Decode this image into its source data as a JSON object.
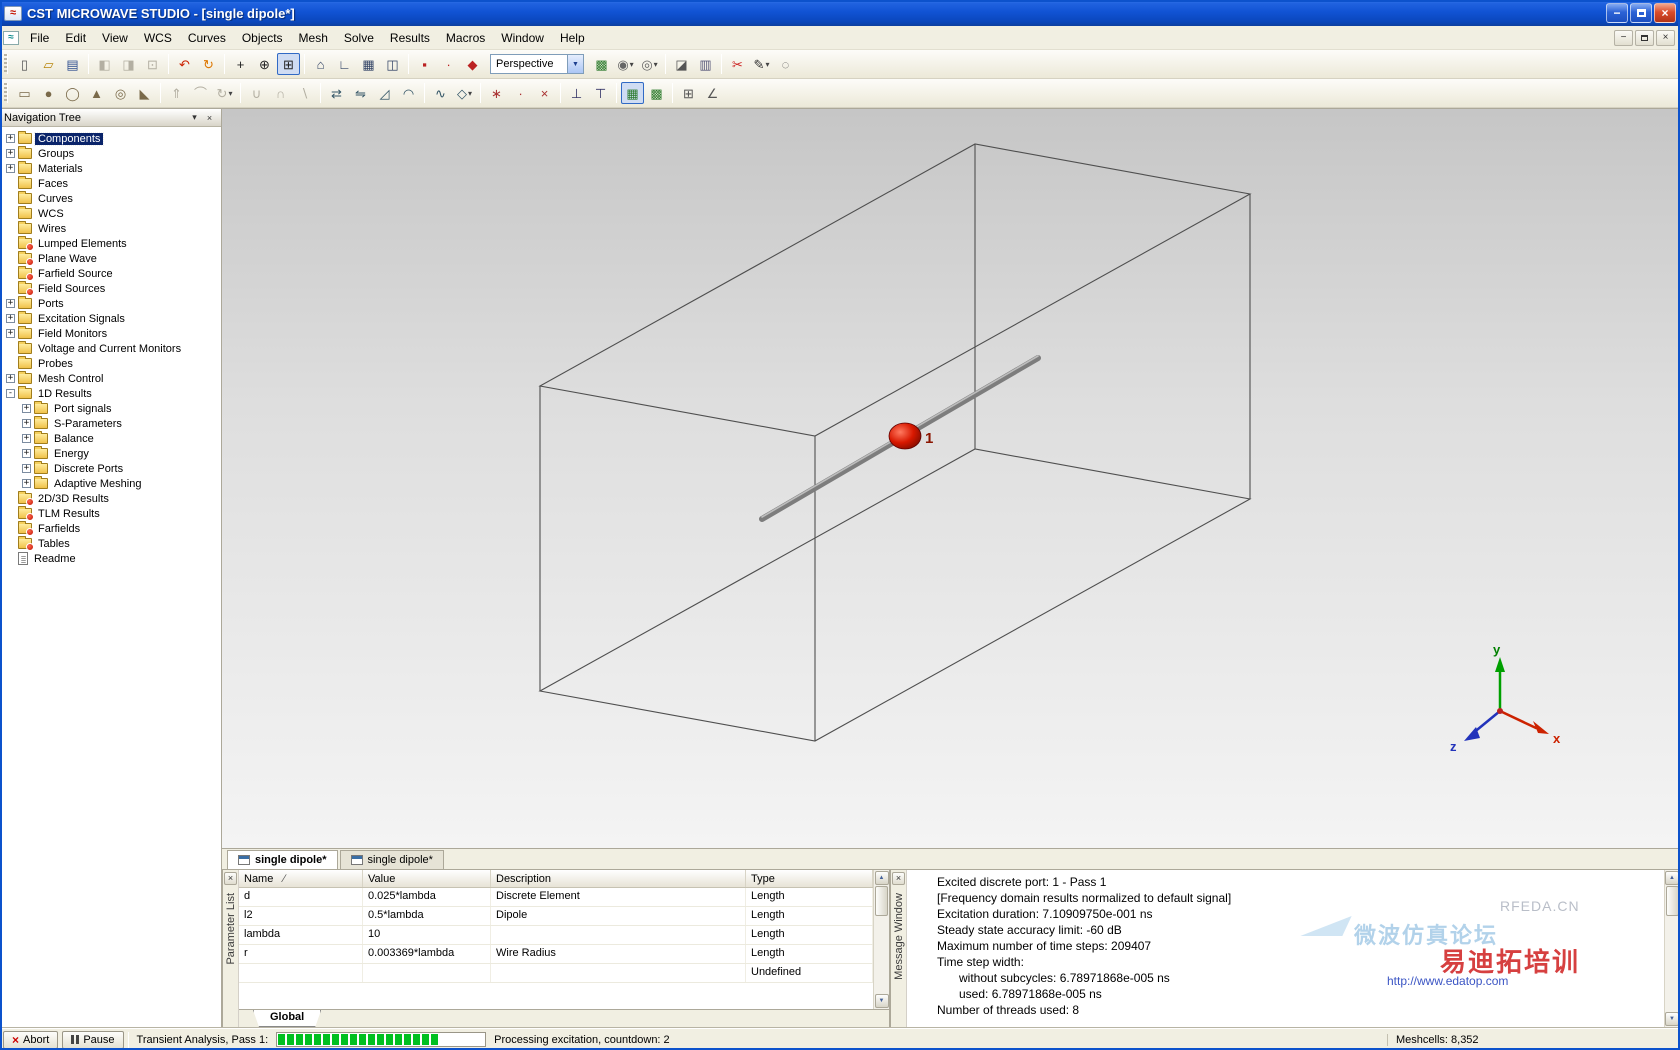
{
  "window": {
    "title": "CST MICROWAVE STUDIO - [single dipole*]"
  },
  "icons": {
    "app_logo": "≈",
    "close": "×",
    "minimize": "−",
    "dropdown": "▾",
    "scroll_up": "▲",
    "scroll_down": "▼",
    "combo_arrow": "▼"
  },
  "menu": {
    "items": [
      "File",
      "Edit",
      "View",
      "WCS",
      "Curves",
      "Objects",
      "Mesh",
      "Solve",
      "Results",
      "Macros",
      "Window",
      "Help"
    ]
  },
  "toolbar_main": {
    "perspective": "Perspective",
    "items": [
      {
        "t": "b",
        "name": "new-file",
        "g": "▯",
        "c": "#555555"
      },
      {
        "t": "b",
        "name": "open-file",
        "g": "▱",
        "c": "#b8860b"
      },
      {
        "t": "b",
        "name": "save",
        "g": "▤",
        "c": "#2f4f8f"
      },
      {
        "t": "s"
      },
      {
        "t": "b",
        "name": "copy-image",
        "g": "◧",
        "c": "#888888",
        "st": "disabled"
      },
      {
        "t": "b",
        "name": "export-image",
        "g": "◨",
        "c": "#888888",
        "st": "disabled"
      },
      {
        "t": "b",
        "name": "print",
        "g": "⊡",
        "c": "#888888",
        "st": "disabled"
      },
      {
        "t": "s"
      },
      {
        "t": "b",
        "name": "undo",
        "g": "↶",
        "c": "#cc2200"
      },
      {
        "t": "b",
        "name": "redo",
        "g": "↻",
        "c": "#dd7700"
      },
      {
        "t": "s"
      },
      {
        "t": "b",
        "name": "pan-view",
        "g": "+",
        "c": "#222222"
      },
      {
        "t": "b",
        "name": "zoom-in",
        "g": "⊕",
        "c": "#222222"
      },
      {
        "t": "b",
        "name": "zoom-window",
        "g": "⊞",
        "c": "#222222",
        "st": "pressed"
      },
      {
        "t": "s"
      },
      {
        "t": "b",
        "name": "reset-view",
        "g": "⌂",
        "c": "#334466"
      },
      {
        "t": "b",
        "name": "axis-view",
        "g": "∟",
        "c": "#334466"
      },
      {
        "t": "b",
        "name": "grid-view",
        "g": "▦",
        "c": "#334466"
      },
      {
        "t": "b",
        "name": "wireframe-view",
        "g": "◫",
        "c": "#334466"
      },
      {
        "t": "s"
      },
      {
        "t": "b",
        "name": "pick-point",
        "g": "▪",
        "c": "#bb2222"
      },
      {
        "t": "b",
        "name": "pick-edge",
        "g": "∙",
        "c": "#bb2222"
      },
      {
        "t": "b",
        "name": "pick-face",
        "g": "◆",
        "c": "#bb2222"
      },
      {
        "t": "combo",
        "name": "perspective-select"
      },
      {
        "t": "b",
        "name": "mesh-view",
        "g": "▩",
        "c": "#2a7a2a"
      },
      {
        "t": "b",
        "name": "material-view",
        "g": "◉",
        "c": "#666666",
        "dd": true
      },
      {
        "t": "b",
        "name": "result-view",
        "g": "◎",
        "c": "#666666",
        "dd": true
      },
      {
        "t": "s"
      },
      {
        "t": "b",
        "name": "cutting-plane",
        "g": "◪",
        "c": "#555555"
      },
      {
        "t": "b",
        "name": "farfield-plot",
        "g": "▥",
        "c": "#555577"
      },
      {
        "t": "s"
      },
      {
        "t": "b",
        "name": "cut-object",
        "g": "✂",
        "c": "#cc2222"
      },
      {
        "t": "b",
        "name": "edit-pen",
        "g": "✎",
        "c": "#333333",
        "dd": true
      },
      {
        "t": "b",
        "name": "delete-object",
        "g": "◌",
        "c": "#555555"
      }
    ]
  },
  "toolbar_modeling": {
    "items": [
      {
        "t": "b",
        "name": "create-brick",
        "g": "▭",
        "c": "#7a6a4a"
      },
      {
        "t": "b",
        "name": "create-sphere",
        "g": "●",
        "c": "#7a6a4a"
      },
      {
        "t": "b",
        "name": "create-cylinder",
        "g": "◯",
        "c": "#7a6a4a"
      },
      {
        "t": "b",
        "name": "create-cone",
        "g": "▲",
        "c": "#7a6a4a"
      },
      {
        "t": "b",
        "name": "create-torus",
        "g": "◎",
        "c": "#7a6a4a"
      },
      {
        "t": "b",
        "name": "create-wedge",
        "g": "◣",
        "c": "#7a6a4a"
      },
      {
        "t": "s"
      },
      {
        "t": "b",
        "name": "extrude",
        "g": "⇑",
        "c": "#556677",
        "st": "disabled"
      },
      {
        "t": "b",
        "name": "loft",
        "g": "⌒",
        "c": "#556677",
        "st": "disabled"
      },
      {
        "t": "b",
        "name": "rotate-solid",
        "g": "↻",
        "c": "#556677",
        "st": "disabled",
        "dd": true
      },
      {
        "t": "s"
      },
      {
        "t": "b",
        "name": "boolean-add",
        "g": "∪",
        "c": "#556677",
        "st": "disabled"
      },
      {
        "t": "b",
        "name": "boolean-subtract",
        "g": "∩",
        "c": "#556677",
        "st": "disabled"
      },
      {
        "t": "b",
        "name": "boolean-cut",
        "g": "∖",
        "c": "#556677",
        "st": "disabled"
      },
      {
        "t": "s"
      },
      {
        "t": "b",
        "name": "transform",
        "g": "⇄",
        "c": "#335566"
      },
      {
        "t": "b",
        "name": "mirror",
        "g": "⇋",
        "c": "#335566"
      },
      {
        "t": "b",
        "name": "chamfer",
        "g": "◿",
        "c": "#335566"
      },
      {
        "t": "b",
        "name": "blend",
        "g": "◠",
        "c": "#335566"
      },
      {
        "t": "s"
      },
      {
        "t": "b",
        "name": "create-curve",
        "g": "∿",
        "c": "#335566"
      },
      {
        "t": "b",
        "name": "create-polygon",
        "g": "◇",
        "c": "#335566",
        "dd": true
      },
      {
        "t": "s"
      },
      {
        "t": "b",
        "name": "pick-points-tool",
        "g": "∗",
        "c": "#aa3333"
      },
      {
        "t": "b",
        "name": "pick-center",
        "g": "∙",
        "c": "#aa3333"
      },
      {
        "t": "b",
        "name": "clear-picks",
        "g": "×",
        "c": "#aa3333"
      },
      {
        "t": "s"
      },
      {
        "t": "b",
        "name": "wcs-tool",
        "g": "⊥",
        "c": "#333366"
      },
      {
        "t": "b",
        "name": "align-wcs",
        "g": "⊤",
        "c": "#333366"
      },
      {
        "t": "s"
      },
      {
        "t": "b",
        "name": "mesh-properties",
        "g": "▦",
        "c": "#2a7a2a",
        "st": "pressed"
      },
      {
        "t": "b",
        "name": "global-mesh",
        "g": "▩",
        "c": "#2a7a2a"
      },
      {
        "t": "s"
      },
      {
        "t": "b",
        "name": "workplane",
        "g": "⊞",
        "c": "#555555"
      },
      {
        "t": "b",
        "name": "measure",
        "g": "∠",
        "c": "#555555"
      }
    ]
  },
  "nav_tree": {
    "title": "Navigation Tree",
    "items": [
      {
        "label": "Components",
        "level": 0,
        "expand": "+",
        "icon": "folder",
        "selected": true
      },
      {
        "label": "Groups",
        "level": 0,
        "expand": "+",
        "icon": "folder"
      },
      {
        "label": "Materials",
        "level": 0,
        "expand": "+",
        "icon": "folder"
      },
      {
        "label": "Faces",
        "level": 0,
        "icon": "folder"
      },
      {
        "label": "Curves",
        "level": 0,
        "icon": "folder"
      },
      {
        "label": "WCS",
        "level": 0,
        "icon": "folder"
      },
      {
        "label": "Wires",
        "level": 0,
        "icon": "folder"
      },
      {
        "label": "Lumped Elements",
        "level": 0,
        "icon": "folder-red"
      },
      {
        "label": "Plane Wave",
        "level": 0,
        "icon": "folder-red"
      },
      {
        "label": "Farfield Source",
        "level": 0,
        "icon": "folder-red"
      },
      {
        "label": "Field Sources",
        "level": 0,
        "icon": "folder-red"
      },
      {
        "label": "Ports",
        "level": 0,
        "expand": "+",
        "icon": "folder"
      },
      {
        "label": "Excitation Signals",
        "level": 0,
        "expand": "+",
        "icon": "folder"
      },
      {
        "label": "Field Monitors",
        "level": 0,
        "expand": "+",
        "icon": "folder"
      },
      {
        "label": "Voltage and Current Monitors",
        "level": 0,
        "icon": "folder"
      },
      {
        "label": "Probes",
        "level": 0,
        "icon": "folder"
      },
      {
        "label": "Mesh Control",
        "level": 0,
        "expand": "+",
        "icon": "folder"
      },
      {
        "label": "1D Results",
        "level": 0,
        "expand": "-",
        "icon": "folder"
      },
      {
        "label": "Port signals",
        "level": 1,
        "expand": "+",
        "icon": "folder"
      },
      {
        "label": "S-Parameters",
        "level": 1,
        "expand": "+",
        "icon": "folder"
      },
      {
        "label": "Balance",
        "level": 1,
        "expand": "+",
        "icon": "folder"
      },
      {
        "label": "Energy",
        "level": 1,
        "expand": "+",
        "icon": "folder"
      },
      {
        "label": "Discrete Ports",
        "level": 1,
        "expand": "+",
        "icon": "folder"
      },
      {
        "label": "Adaptive Meshing",
        "level": 1,
        "expand": "+",
        "icon": "folder"
      },
      {
        "label": "2D/3D Results",
        "level": 0,
        "icon": "folder-red"
      },
      {
        "label": "TLM Results",
        "level": 0,
        "icon": "folder-red"
      },
      {
        "label": "Farfields",
        "level": 0,
        "icon": "folder-red"
      },
      {
        "label": "Tables",
        "level": 0,
        "icon": "folder-red"
      },
      {
        "label": "Readme",
        "level": 0,
        "icon": "doc"
      }
    ]
  },
  "viewport": {
    "port_label": "1",
    "axis_x": "x",
    "axis_y": "y",
    "axis_z": "z"
  },
  "doc_tabs": {
    "tabs": [
      {
        "label": "single dipole*",
        "active": true
      },
      {
        "label": "single dipole*",
        "active": false
      }
    ]
  },
  "parameter_list": {
    "panel_label": "Parameter List",
    "sheet_tab": "Global",
    "columns": [
      {
        "label": "Name",
        "sort": "∕"
      },
      {
        "label": "Value"
      },
      {
        "label": "Description"
      },
      {
        "label": "Type"
      }
    ],
    "rows": [
      [
        "d",
        "0.025*lambda",
        "Discrete Element",
        "Length"
      ],
      [
        "l2",
        "0.5*lambda",
        "Dipole",
        "Length"
      ],
      [
        "lambda",
        "10",
        "",
        "Length"
      ],
      [
        "r",
        "0.003369*lambda",
        "Wire Radius",
        "Length"
      ],
      [
        "",
        "",
        "",
        "Undefined"
      ]
    ]
  },
  "message_window": {
    "panel_label": "Message Window",
    "lines": [
      {
        "text": "Excited discrete port: 1 - Pass 1",
        "indent": 0
      },
      {
        "text": "[Frequency domain results normalized to default signal]",
        "indent": 0
      },
      {
        "text": "Excitation duration: 7.10909750e-001 ns",
        "indent": 0
      },
      {
        "text": "Steady state accuracy limit: -60 dB",
        "indent": 0
      },
      {
        "text": "Maximum number of time steps: 209407",
        "indent": 0
      },
      {
        "text": "Time step width:",
        "indent": 0
      },
      {
        "text": "without subcycles: 6.78971868e-005 ns",
        "indent": 1
      },
      {
        "text": "used: 6.78971868e-005 ns",
        "indent": 1
      },
      {
        "text": "Number of threads used: 8",
        "indent": 0
      }
    ]
  },
  "status_bar": {
    "abort_label": "Abort",
    "pause_label": "Pause",
    "task_label": "Transient Analysis, Pass 1:",
    "progress_percent": 78,
    "status_message": "Processing excitation, countdown: 2",
    "right_info": "Meshcells: 8,352"
  },
  "watermarks": {
    "site": "RFEDA.CN",
    "forum": "微波仿真论坛",
    "training": "易迪拓培训",
    "url": "http://www.edatop.com"
  },
  "colors": {
    "selection_blue": "#0a246a",
    "titlebar_blue": "#1153d4",
    "chrome_tan": "#f1efe2",
    "progress_green": "#00c020",
    "port_red": "#d81800"
  }
}
